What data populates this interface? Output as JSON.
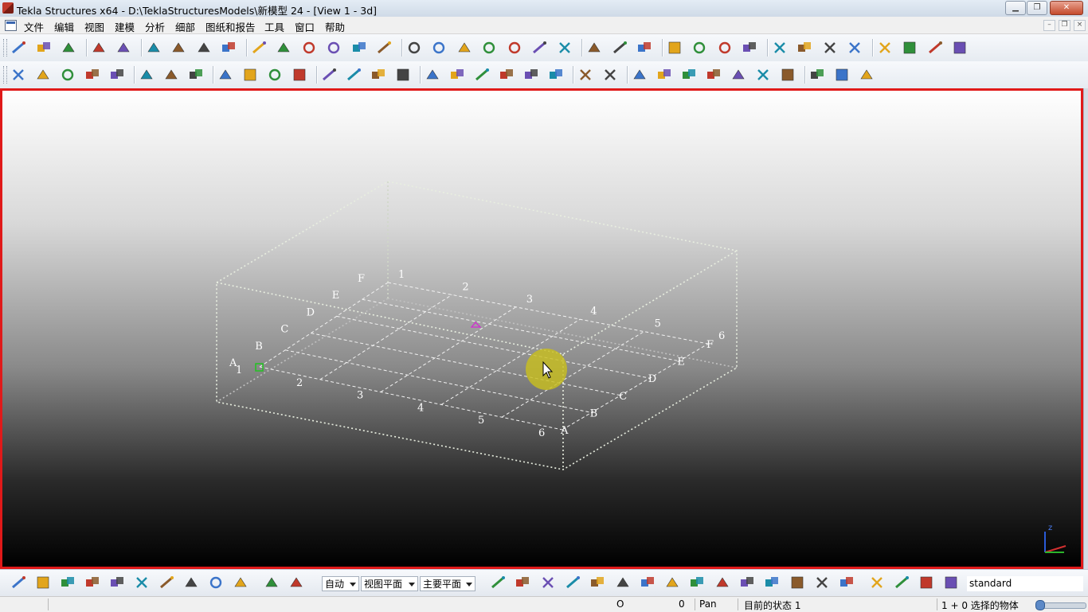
{
  "window": {
    "title": "Tekla Structures x64 - D:\\TeklaStructuresModels\\新模型 24 - [View 1 - 3d]",
    "minimize_glyph": "▁",
    "restore_glyph": "❐",
    "close_glyph": "✕"
  },
  "menu": {
    "items": [
      "文件",
      "编辑",
      "视图",
      "建模",
      "分析",
      "细部",
      "图纸和报告",
      "工具",
      "窗口",
      "帮助"
    ],
    "mdi_controls": [
      "–",
      "❐",
      "×"
    ]
  },
  "toolbar_top": {
    "icons": [
      "new-file-icon",
      "open-folder-icon",
      "save-icon",
      "undo-icon",
      "redo-icon",
      "copy-icon",
      "move-icon",
      "list-icon",
      "phase-icon",
      "view-box-icon",
      "view-props-icon",
      "list-edit-icon",
      "cut-icon",
      "select-area-icon",
      "part-box-icon",
      "part-copy-icon",
      "part-move-icon",
      "clip-icon",
      "component-icon",
      "component-arrow-icon",
      "assembly-icon",
      "assembly-add-icon",
      "help-query-icon",
      "grid-pin-icon",
      "grid-corner-icon",
      "angle-measure-icon",
      "dimension-icon",
      "arc-icon",
      "frame-icon",
      "marker-icon",
      "layer-icon",
      "report-icon",
      "export-icon",
      "render-icon",
      "arrow-forward-icon",
      "analysis-icon",
      "toolbox-icon"
    ]
  },
  "toolbar_second": {
    "icons": [
      "column-icon",
      "beam-icon",
      "bent-beam-icon",
      "curved-beam-icon",
      "plate-icon",
      "bolt-icon",
      "weld-icon",
      "rebar-icon",
      "binoculars-icon",
      "steel-profile-icon",
      "structure-icon",
      "contour-plate-icon",
      "cut-line-icon",
      "part-cut-icon",
      "polygon-cut-icon",
      "fitting-icon",
      "line-icon",
      "dotted-line-icon",
      "parallel-lines-icon",
      "angle-lines-icon",
      "cross-icon",
      "point-icon",
      "dashed-icon",
      "circle-point-icon",
      "slab-icon",
      "panel-icon",
      "pad-footing-icon",
      "strip-icon",
      "bent-plate-icon",
      "folded-plate-icon",
      "surface-icon",
      "u-bar-icon",
      "stirrup-icon",
      "mesh-icon"
    ]
  },
  "viewport": {
    "grid_labels_front_numbers": [
      "1",
      "2",
      "3",
      "4",
      "5",
      "6"
    ],
    "grid_labels_back_numbers": [
      "1",
      "2",
      "3",
      "4",
      "5",
      "6"
    ],
    "grid_labels_left_letters": [
      "A",
      "B",
      "C",
      "D",
      "E",
      "F"
    ],
    "grid_labels_right_letters": [
      "A",
      "B",
      "C",
      "D",
      "E",
      "F"
    ],
    "axis_label": "z"
  },
  "bottom_toolbar": {
    "snap_icons": [
      "snap-end-icon",
      "snap-midpoint-icon",
      "snap-center-icon",
      "snap-intersection-icon",
      "snap-delete-icon",
      "snap-perpendicular-icon",
      "snap-extension-icon",
      "snap-check-icon",
      "snap-free-icon",
      "snap-arrow-icon",
      "view-plane-icon",
      "work-plane-icon"
    ],
    "select_depth": "自动",
    "select_plane": "视图平面",
    "select_main": "主要平面",
    "selection_icons": [
      "select-pointer-icon",
      "select-part-icon",
      "select-point-icon",
      "select-surface-icon",
      "select-grid-icon",
      "select-grid-line-icon",
      "select-weld-icon",
      "select-cut-icon",
      "select-view-icon",
      "select-component-icon",
      "select-bolt-icon",
      "select-connection-icon",
      "select-detail-icon",
      "select-plane-icon",
      "select-snap-icon",
      "select-assembly-up-icon",
      "select-assembly-down-icon",
      "select-object-icon",
      "select-object-group-icon"
    ],
    "filter_value": "standard"
  },
  "status": {
    "field1": "O",
    "field2": "0",
    "mode": "Pan",
    "current_phase": "目前的状态 1",
    "selection": "1 + 0 选择的物体"
  }
}
